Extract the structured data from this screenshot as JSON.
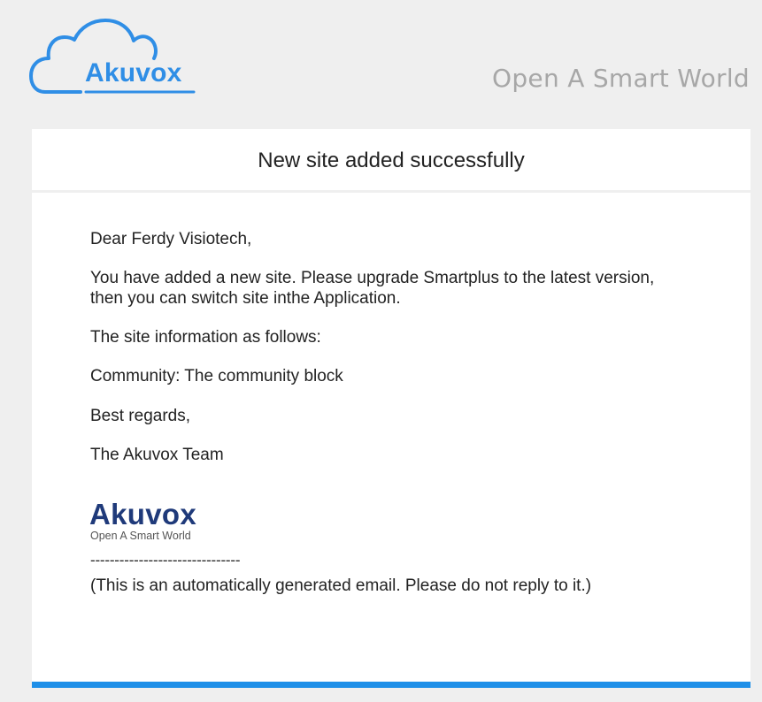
{
  "header": {
    "logo_text": "Akuvox",
    "tagline": "Open A Smart World"
  },
  "email": {
    "title": "New site added successfully",
    "greeting": "Dear Ferdy Visiotech,",
    "paragraph1_line1": "You have added a new site. Please upgrade Smartplus to the latest version,",
    "paragraph1_line2": "then you can switch site inthe Application.",
    "info_intro": "The site information as follows:",
    "community_line": "Community: The community block",
    "closing": "Best regards,",
    "team": "The Akuvox Team",
    "divider": "-------------------------------",
    "auto_notice": "(This is an automatically generated email. Please do not reply to it.)"
  },
  "signature_logo": {
    "word": "Akuvox",
    "tagline": "Open A Smart World"
  },
  "colors": {
    "background": "#efefef",
    "brand_blue": "#2f8ee6",
    "navy": "#1f3a7a",
    "tagline_gray": "#a7a7a7",
    "bottom_bar": "#1e8fe8"
  }
}
